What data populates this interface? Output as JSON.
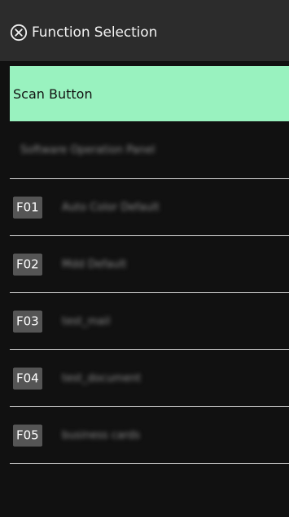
{
  "header": {
    "title": "Function Selection",
    "close_icon": "circle-x-icon"
  },
  "list": {
    "items": [
      {
        "badge": "",
        "label": "Scan Button",
        "selected": true
      },
      {
        "badge": "",
        "label": "Software Operation Panel",
        "selected": false,
        "blurred": true
      },
      {
        "badge": "F01",
        "label": "Auto Color Default",
        "selected": false,
        "blurred": true
      },
      {
        "badge": "F02",
        "label": "Mdd Default",
        "selected": false,
        "blurred": true
      },
      {
        "badge": "F03",
        "label": "test_mail",
        "selected": false,
        "blurred": true
      },
      {
        "badge": "F04",
        "label": "test_document",
        "selected": false,
        "blurred": true
      },
      {
        "badge": "F05",
        "label": "business cards",
        "selected": false,
        "blurred": true
      }
    ]
  },
  "colors": {
    "header_bg": "#2c2c2c",
    "panel_bg": "#111111",
    "selected_bg": "#99f2bf",
    "badge_bg": "#555555",
    "divider": "#dcdcdc"
  }
}
